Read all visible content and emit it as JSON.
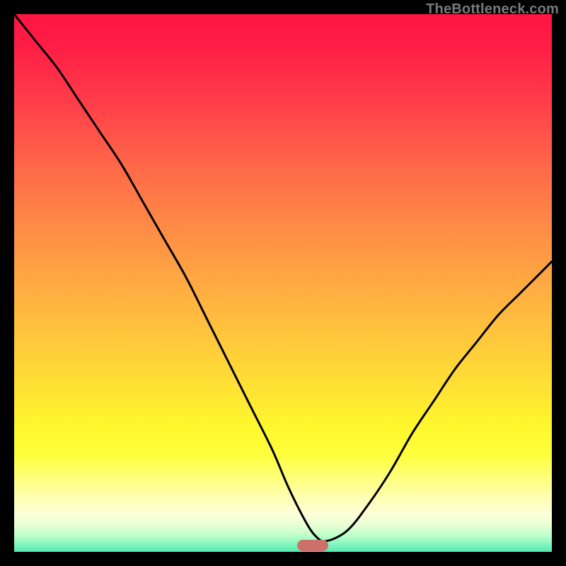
{
  "watermark": "TheBottleneck.com",
  "marker": {
    "color": "#cd6f6a",
    "x_frac": 0.555,
    "y_frac": 0.988
  },
  "chart_data": {
    "type": "line",
    "title": "",
    "xlabel": "",
    "ylabel": "",
    "xlim": [
      0,
      100
    ],
    "ylim": [
      0,
      100
    ],
    "grid": false,
    "legend": false,
    "background": "vertical-gradient red→orange→yellow→pale→green",
    "annotations": [
      {
        "kind": "pill",
        "x": 55.5,
        "y": 1.2,
        "color": "#cd6f6a"
      }
    ],
    "series": [
      {
        "name": "curve",
        "x": [
          0,
          4,
          8,
          12,
          16,
          20,
          24,
          28,
          32,
          36,
          40,
          44,
          48,
          51,
          54,
          56,
          58,
          62,
          66,
          70,
          74,
          78,
          82,
          86,
          90,
          94,
          98,
          100
        ],
        "y": [
          100,
          95,
          90,
          84,
          78,
          72,
          65,
          58,
          51,
          43,
          35,
          27,
          19,
          12,
          6,
          3,
          2,
          4,
          9,
          15,
          22,
          28,
          34,
          39,
          44,
          48,
          52,
          54
        ],
        "stroke": "#000000",
        "stroke_width": 3
      }
    ]
  }
}
